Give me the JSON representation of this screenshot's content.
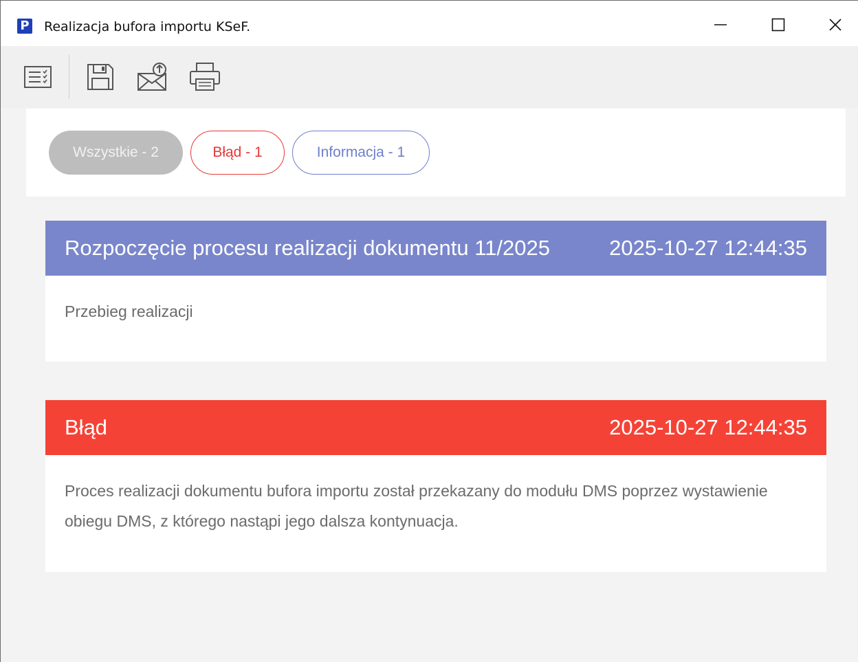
{
  "window": {
    "title": "Realizacja bufora importu KSeF.",
    "app_icon_letter": "P",
    "icons": [
      "app-icon",
      "minimize-icon",
      "maximize-icon",
      "close-icon"
    ]
  },
  "toolbar": {
    "icons": [
      "checklist-icon",
      "save-icon",
      "send-mail-icon",
      "print-icon"
    ]
  },
  "filters": {
    "all": "Wszystkie - 2",
    "error": "Błąd - 1",
    "info": "Informacja - 1"
  },
  "messages": [
    {
      "type": "info",
      "title": "Rozpoczęcie procesu realizacji dokumentu 11/2025",
      "timestamp": "2025-10-27 12:44:35",
      "body": "Przebieg realizacji"
    },
    {
      "type": "error",
      "title": "Błąd",
      "timestamp": "2025-10-27 12:44:35",
      "body": "Proces realizacji dokumentu bufora importu został przekazany do modułu DMS poprzez wystawienie obiegu DMS, z którego nastąpi jego dalsza kontynuacja."
    }
  ],
  "colors": {
    "info_header": "#7986cb",
    "error_header": "#f44336",
    "pill_all_bg": "#bdbdbd",
    "pill_error": "#e53935",
    "pill_info": "#6f7ecc",
    "app_icon": "#1e3fb8"
  }
}
